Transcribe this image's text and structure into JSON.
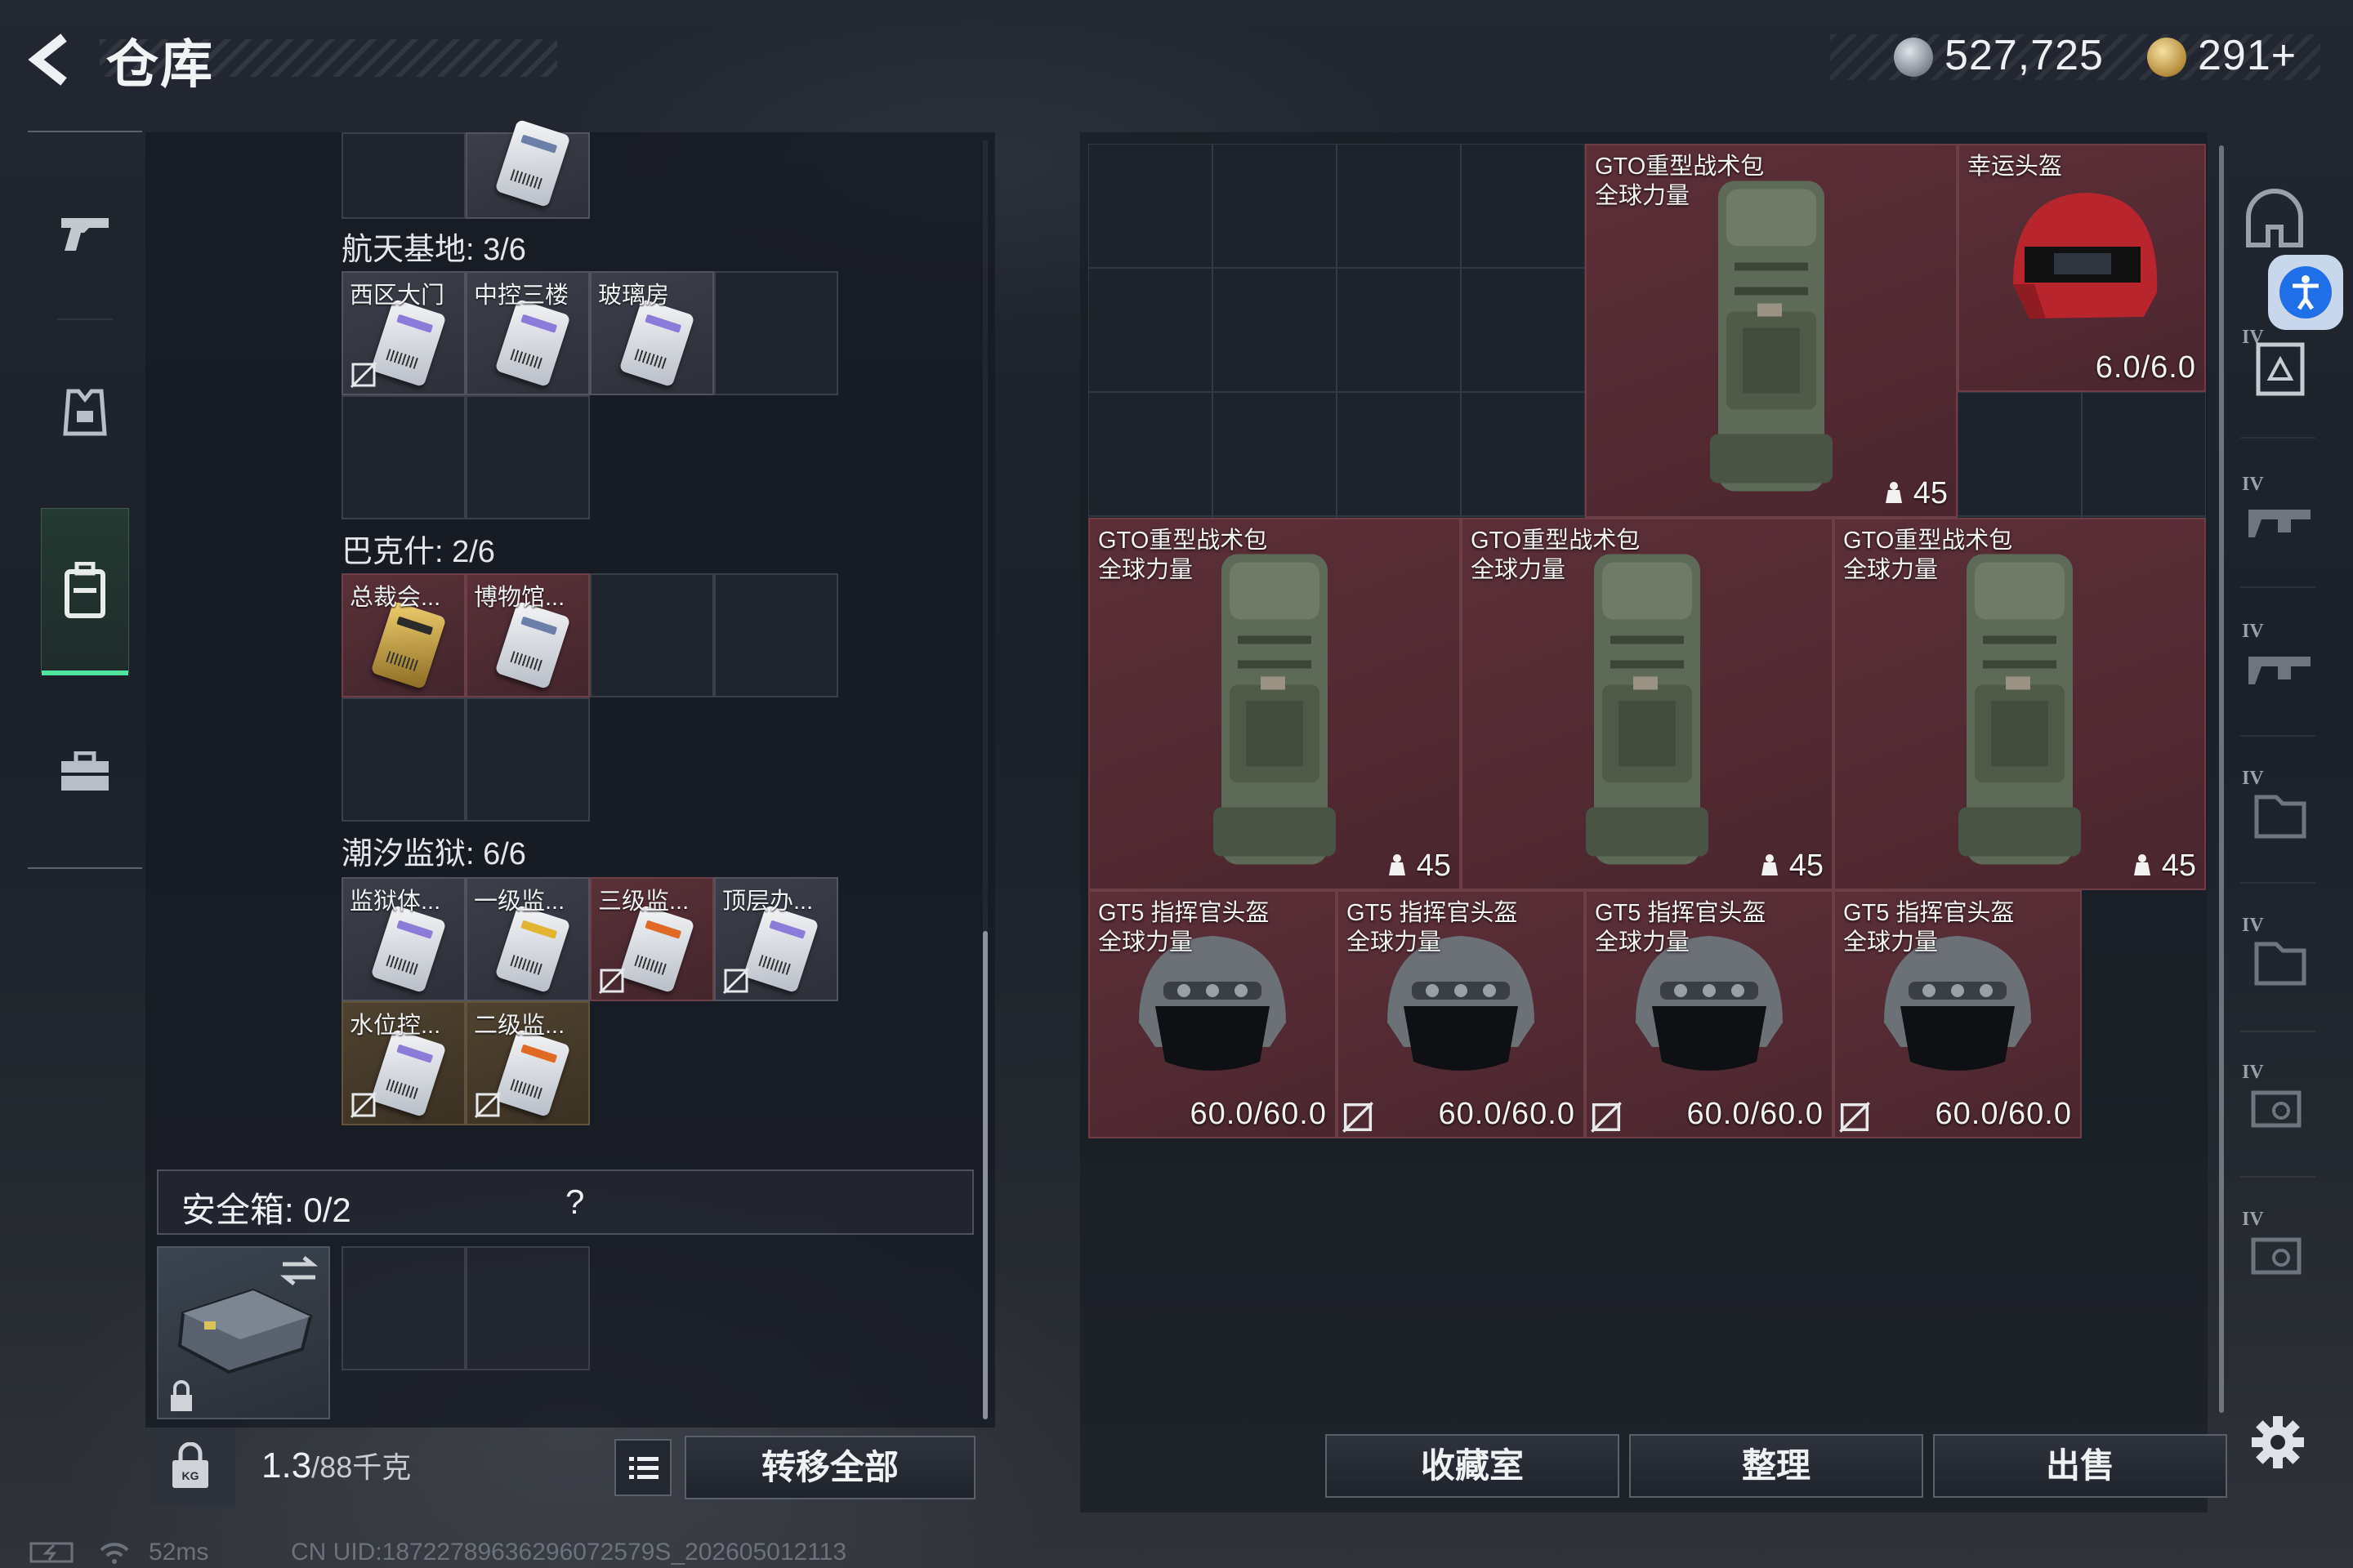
{
  "header": {
    "title": "仓库",
    "currency_silver": "527,725",
    "currency_gold": "291+"
  },
  "stash": {
    "groups": [
      {
        "label": "航天基地: 3/6",
        "items": [
          {
            "label": "西区大门",
            "no_trade": true
          },
          {
            "label": "中控三楼",
            "no_trade": false
          },
          {
            "label": "玻璃房",
            "no_trade": false
          }
        ]
      },
      {
        "label": "巴克什: 2/6",
        "items": [
          {
            "label": "总裁会...",
            "no_trade": false
          },
          {
            "label": "博物馆...",
            "no_trade": false
          }
        ]
      },
      {
        "label": "潮汐监狱: 6/6",
        "items": [
          {
            "label": "监狱体...",
            "no_trade": false
          },
          {
            "label": "一级监...",
            "no_trade": false
          },
          {
            "label": "三级监...",
            "no_trade": true
          },
          {
            "label": "顶层办...",
            "no_trade": true
          },
          {
            "label": "水位控...",
            "no_trade": true
          },
          {
            "label": "二级监...",
            "no_trade": true
          }
        ]
      }
    ],
    "safe_box": {
      "label": "安全箱: 0/2",
      "help": "?"
    },
    "weight": {
      "value": "1.3",
      "max": "/88",
      "unit": "千克"
    },
    "transfer_all": "转移全部"
  },
  "status": {
    "ping": "52ms",
    "uid": "CN UID:18722789636296072579S_202605012113"
  },
  "container": {
    "items": [
      {
        "name_line1": "GTO重型战术包",
        "name_line2": "全球力量",
        "value": "45",
        "kind": "backpack"
      },
      {
        "name_line1": "幸运头盔",
        "name_line2": "",
        "value": "6.0/6.0",
        "kind": "helmet-red"
      },
      {
        "name_line1": "GTO重型战术包",
        "name_line2": "全球力量",
        "value": "45",
        "kind": "backpack"
      },
      {
        "name_line1": "GTO重型战术包",
        "name_line2": "全球力量",
        "value": "45",
        "kind": "backpack"
      },
      {
        "name_line1": "GTO重型战术包",
        "name_line2": "全球力量",
        "value": "45",
        "kind": "backpack"
      },
      {
        "name_line1": "GT5 指挥官头盔",
        "name_line2": "全球力量",
        "value": "60.0/60.0",
        "kind": "helmet"
      },
      {
        "name_line1": "GT5 指挥官头盔",
        "name_line2": "全球力量",
        "value": "60.0/60.0",
        "kind": "helmet"
      },
      {
        "name_line1": "GT5 指挥官头盔",
        "name_line2": "全球力量",
        "value": "60.0/60.0",
        "kind": "helmet"
      },
      {
        "name_line1": "GT5 指挥官头盔",
        "name_line2": "全球力量",
        "value": "60.0/60.0",
        "kind": "helmet"
      }
    ],
    "buttons": {
      "collection": "收藏室",
      "organize": "整理",
      "sell": "出售"
    }
  },
  "equipment_rail": {
    "tiers": [
      "IV",
      "IV",
      "IV",
      "IV",
      "IV",
      "IV",
      "IV"
    ]
  },
  "colors": {
    "accent_green": "#4fe3a0",
    "item_red_bg": "#5c2f38",
    "accessibility_blue": "#1f6fe8"
  }
}
